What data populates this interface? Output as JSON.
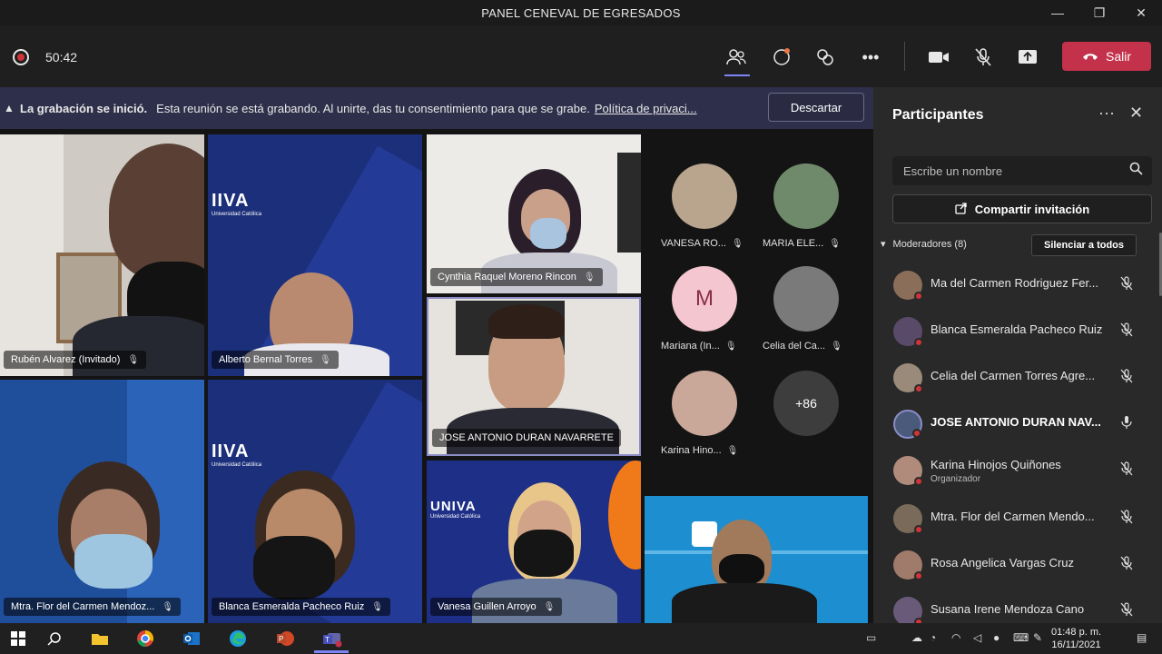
{
  "window": {
    "title": "PANEL CENEVAL DE EGRESADOS",
    "minimize": "—",
    "restore": "❐",
    "close": "✕"
  },
  "toolbar": {
    "timer": "50:42",
    "leave_label": "Salir",
    "icons": [
      "people-icon",
      "chat-icon",
      "reactions-icon",
      "more-icon",
      "camera-icon",
      "mic-off-icon",
      "share-tray-icon"
    ]
  },
  "banner": {
    "bold": "La grabación se inició.",
    "text": "Esta reunión se está grabando. Al unirte, das tu consentimiento para que se grabe.",
    "link": "Política de privaci...",
    "dismiss": "Descartar"
  },
  "tiles": [
    {
      "name": "Rubén Alvarez (Invitado)"
    },
    {
      "name": "Alberto Bernal Torres",
      "logo": "IIVA",
      "logo_sub": "Universidad Católica"
    },
    {
      "name": "Cynthia Raquel Moreno Rincon"
    },
    {
      "name": "JOSE ANTONIO DURAN NAVARRETE"
    },
    {
      "name": "Mtra. Flor del Carmen Mendoz..."
    },
    {
      "name": "Blanca Esmeralda Pacheco Ruiz",
      "logo": "IIVA",
      "logo_sub": "Universidad Católica"
    },
    {
      "name": "Vanesa Guillen Arroyo",
      "logo": "UNIVA",
      "logo_sub": "Universidad Católica"
    },
    {
      "name": ""
    }
  ],
  "avatars": [
    {
      "label": "VANESA RO...",
      "color": "#b9a48e"
    },
    {
      "label": "MARIA ELE...",
      "color": "#6f8a6a"
    },
    {
      "label": "Mariana (In...",
      "initial": "M",
      "color": "#f4c6cf"
    },
    {
      "label": "Celia del Ca...",
      "color": "#7a7a7a"
    },
    {
      "label": "Karina Hino...",
      "color": "#c9a89a"
    },
    {
      "label": "",
      "more": "+86",
      "color": "#3d3d3d"
    }
  ],
  "panel": {
    "title": "Participantes",
    "search_placeholder": "Escribe un nombre",
    "share_label": "Compartir invitación",
    "section_label": "Moderadores (8)",
    "mute_all": "Silenciar a todos",
    "participants": [
      {
        "name": "Ma del Carmen Rodriguez Fer...",
        "color": "#8a6e5a"
      },
      {
        "name": "Blanca Esmeralda Pacheco Ruiz",
        "color": "#5a4a6a"
      },
      {
        "name": "Celia del Carmen Torres Agre...",
        "color": "#9a8a7a"
      },
      {
        "name": "JOSE ANTONIO DURAN NAV...",
        "color": "#4a5a7a",
        "speaking": true
      },
      {
        "name": "Karina Hinojos Quiñones",
        "sub": "Organizador",
        "color": "#b08a7a"
      },
      {
        "name": "Mtra. Flor del Carmen Mendo...",
        "color": "#7a6a5a"
      },
      {
        "name": "Rosa Angelica Vargas Cruz",
        "color": "#a07a6a"
      },
      {
        "name": "Susana Irene Mendoza Cano",
        "color": "#6a5a7a"
      }
    ]
  },
  "taskbar": {
    "time": "01:48 p. m.",
    "date": "16/11/2021"
  }
}
